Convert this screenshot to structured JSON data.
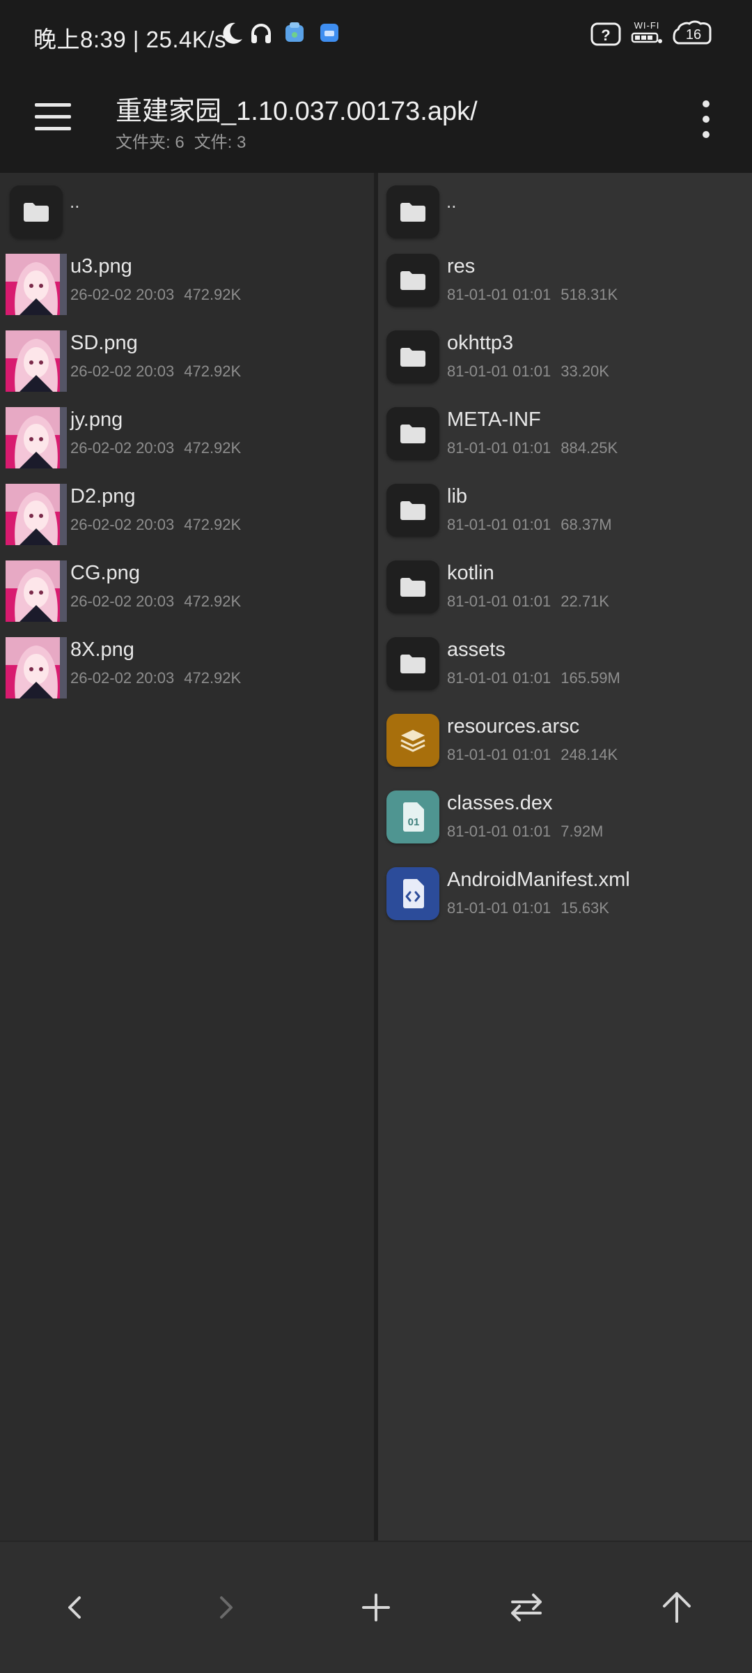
{
  "status_bar": {
    "text": "晚上8:39 | 25.4K/s",
    "battery": "16",
    "wifi_label": "WI-FI"
  },
  "header": {
    "title": "重建家园_1.10.037.00173.apk/",
    "folders_count": "文件夹: 6",
    "files_count": "文件: 3"
  },
  "left_pane": {
    "parent": "..",
    "items": [
      {
        "name": "u3.png",
        "date": "26-02-02 20:03",
        "size": "472.92K"
      },
      {
        "name": "SD.png",
        "date": "26-02-02 20:03",
        "size": "472.92K"
      },
      {
        "name": "jy.png",
        "date": "26-02-02 20:03",
        "size": "472.92K"
      },
      {
        "name": "D2.png",
        "date": "26-02-02 20:03",
        "size": "472.92K"
      },
      {
        "name": "CG.png",
        "date": "26-02-02 20:03",
        "size": "472.92K"
      },
      {
        "name": "8X.png",
        "date": "26-02-02 20:03",
        "size": "472.92K"
      }
    ]
  },
  "right_pane": {
    "parent": "..",
    "items": [
      {
        "name": "res",
        "date": "81-01-01 01:01",
        "size": "518.31K",
        "type": "folder"
      },
      {
        "name": "okhttp3",
        "date": "81-01-01 01:01",
        "size": "33.20K",
        "type": "folder"
      },
      {
        "name": "META-INF",
        "date": "81-01-01 01:01",
        "size": "884.25K",
        "type": "folder"
      },
      {
        "name": "lib",
        "date": "81-01-01 01:01",
        "size": "68.37M",
        "type": "folder"
      },
      {
        "name": "kotlin",
        "date": "81-01-01 01:01",
        "size": "22.71K",
        "type": "folder"
      },
      {
        "name": "assets",
        "date": "81-01-01 01:01",
        "size": "165.59M",
        "type": "folder"
      },
      {
        "name": "resources.arsc",
        "date": "81-01-01 01:01",
        "size": "248.14K",
        "type": "arsc"
      },
      {
        "name": "classes.dex",
        "date": "81-01-01 01:01",
        "size": "7.92M",
        "type": "dex"
      },
      {
        "name": "AndroidManifest.xml",
        "date": "81-01-01 01:01",
        "size": "15.63K",
        "type": "xml"
      }
    ]
  },
  "dex_icon_text": "01",
  "colors": {
    "arsc": "#a86f0c",
    "dex": "#4f9591",
    "xml": "#2c4c9a",
    "background": "#2b2b2b",
    "bar": "#1b1b1b"
  },
  "icons": {
    "status": [
      "moon-icon",
      "headphones-icon",
      "app-icon",
      "app-icon",
      "unknown-network-icon",
      "wifi-icon",
      "battery-icon"
    ],
    "toolbar": [
      "menu-icon",
      "more-vert-icon"
    ],
    "bottom": [
      "back-icon",
      "forward-icon",
      "add-icon",
      "swap-icon",
      "up-icon"
    ]
  }
}
